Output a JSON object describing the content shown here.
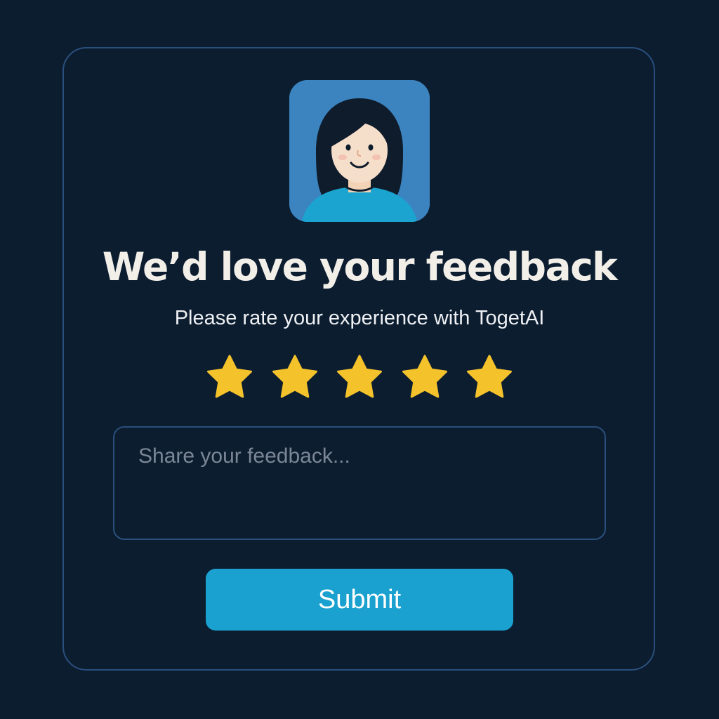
{
  "dialog": {
    "title": "We’d love your feedback",
    "subtitle": "Please rate your experience with TogetAI",
    "avatar_icon": "woman-avatar-icon"
  },
  "rating": {
    "value": 5,
    "max": 5,
    "star_color": "#f4c22b",
    "icon": "star-icon"
  },
  "feedback": {
    "placeholder": "Share your feedback...",
    "value": ""
  },
  "submit": {
    "label": "Submit",
    "color": "#1aa1cf"
  },
  "colors": {
    "background": "#0c1d30",
    "border": "#2a4f7c",
    "avatar_bg": "#3b84c0"
  }
}
